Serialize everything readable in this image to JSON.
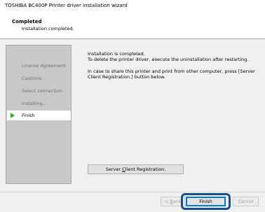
{
  "window": {
    "title": "TOSHIBA BC400P Printer driver installation wizard"
  },
  "header": {
    "title": "Completed",
    "subtitle": "Installation completed."
  },
  "sidebar": {
    "items": [
      {
        "label": "License Agreement",
        "active": false
      },
      {
        "label": "Cautions",
        "active": false
      },
      {
        "label": "Select connection",
        "active": false
      },
      {
        "label": "Installing...",
        "active": false
      },
      {
        "label": "Finish",
        "active": true
      }
    ]
  },
  "content": {
    "line1": "Installation is completed.",
    "line2": "To delete the printer driver, execute the uninstallation after restarting.",
    "line3": "In case to share this printer and print from other computer, press [Server Client Registration.] button below."
  },
  "buttons": {
    "server_reg_pre": "Server ",
    "server_reg_u": "C",
    "server_reg_post": "lient Registration.",
    "back_pre": "< ",
    "back_u": "B",
    "back_post": "ack",
    "finish": "Finish",
    "cancel": "Cancel"
  },
  "colors": {
    "highlight": "#1a4f8c",
    "active_arrow": "#2bb52b",
    "sidebar_bg": "#c8c8c8"
  }
}
